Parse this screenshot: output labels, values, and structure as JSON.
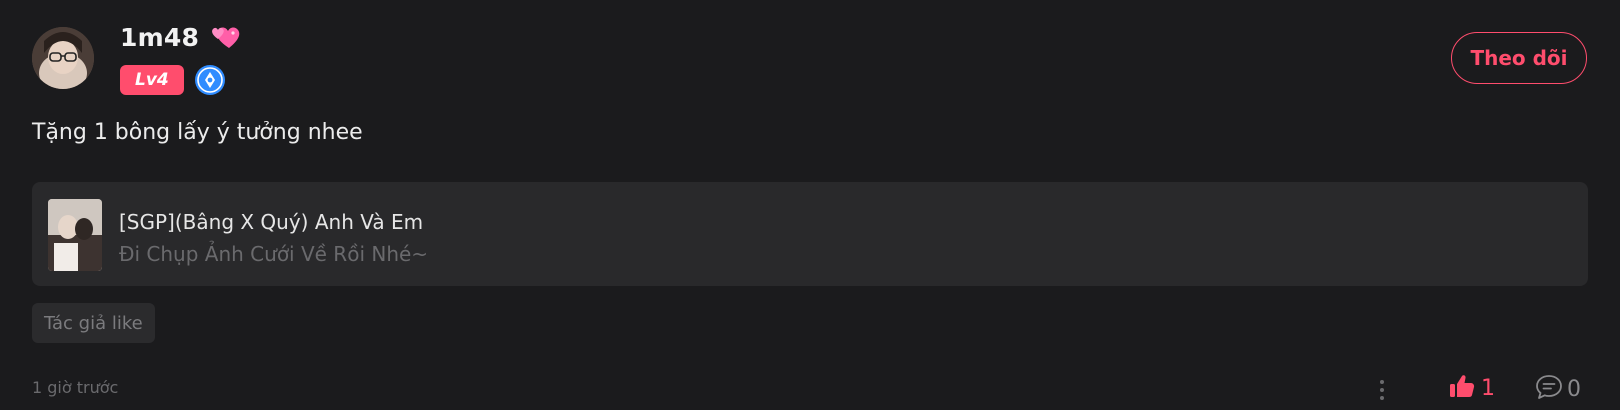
{
  "user": {
    "name": "1m48",
    "level": "Lv4"
  },
  "follow_button": {
    "label": "Theo dõi"
  },
  "comment": {
    "text": "Tặng 1 bông lấy ý tưởng nhee"
  },
  "song": {
    "title": "[SGP](Bâng X Quý) Anh Và Em",
    "subtitle": "Đi Chụp Ảnh Cưới Về Rồi Nhé~"
  },
  "tag": {
    "label": "Tác giả like"
  },
  "footer": {
    "timestamp": "1 giờ trước",
    "like_count": "1",
    "comment_count": "0"
  },
  "colors": {
    "accent": "#ff4d6d",
    "background": "#1b1b1d",
    "card": "#29292b"
  },
  "icons": {
    "avatar": "user-avatar",
    "heart": "two-hearts-icon",
    "creator": "creator-badge-icon",
    "more": "more-vertical-icon",
    "like": "thumbs-up-icon",
    "comment": "comment-bubble-icon"
  }
}
